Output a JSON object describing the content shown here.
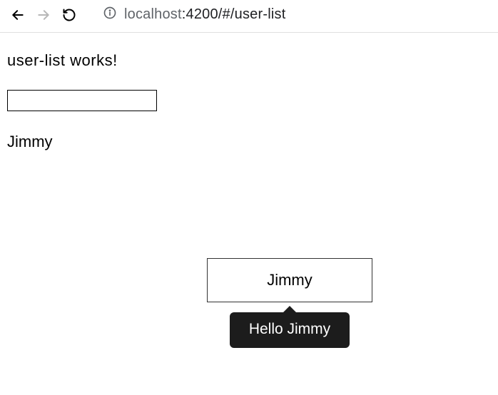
{
  "browser": {
    "url_host": "localhost",
    "url_rest": ":4200/#/user-list"
  },
  "page": {
    "heading": "user-list works!",
    "input_value": "",
    "name": "Jimmy"
  },
  "tooltip": {
    "trigger_label": "Jimmy",
    "message": "Hello Jimmy"
  }
}
